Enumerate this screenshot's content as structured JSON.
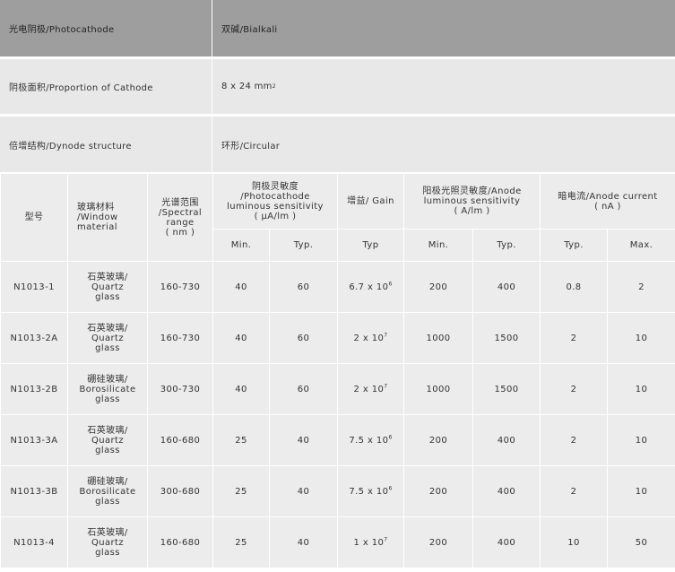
{
  "info": {
    "photocathode": {
      "label": "光电阴极/Photocathode",
      "value": "双碱/Bialkali"
    },
    "cathode_area": {
      "label": "阴极面积/Proportion of Cathode",
      "value": "8 x 24 mm",
      "sup": "2"
    },
    "dynode": {
      "label": "倍增结构/Dynode structure",
      "value": "环形/Circular"
    }
  },
  "table": {
    "headers": {
      "model": "型号",
      "window": "玻璃材料\n/Window\nmaterial",
      "spectral": "光谱范围\n/Spectral\nrange\n( nm )",
      "cathode_sens": "阴极灵敏度\n/Photocathode\nluminous sensitivity\n( μA/lm )",
      "gain": "增益/ Gain",
      "anode_sens": "阳极光照灵敏度/Anode\nluminous sensitivity\n( A/lm )",
      "dark_current": "暗电流/Anode current\n( nA )"
    },
    "subheaders": {
      "cathode_min": "Min.",
      "cathode_typ": "Typ.",
      "gain_typ": "Typ",
      "anode_min": "Min.",
      "anode_typ": "Typ.",
      "dark_typ": "Typ.",
      "dark_max": "Max."
    },
    "rows": [
      {
        "model": "N1013-1",
        "window": "石英玻璃/\nQuartz\nglass",
        "spectral": "160-730",
        "c_min": "40",
        "c_typ": "60",
        "gain_base": "6.7 x 10",
        "gain_exp": "6",
        "a_min": "200",
        "a_typ": "400",
        "d_typ": "0.8",
        "d_max": "2"
      },
      {
        "model": "N1013-2A",
        "window": "石英玻璃/\nQuartz\nglass",
        "spectral": "160-730",
        "c_min": "40",
        "c_typ": "60",
        "gain_base": "2 x 10",
        "gain_exp": "7",
        "a_min": "1000",
        "a_typ": "1500",
        "d_typ": "2",
        "d_max": "10"
      },
      {
        "model": "N1013-2B",
        "window": "硼硅玻璃/\nBorosilicate\nglass",
        "spectral": "300-730",
        "c_min": "40",
        "c_typ": "60",
        "gain_base": "2 x 10",
        "gain_exp": "7",
        "a_min": "1000",
        "a_typ": "1500",
        "d_typ": "2",
        "d_max": "10"
      },
      {
        "model": "N1013-3A",
        "window": "石英玻璃/\nQuartz\nglass",
        "spectral": "160-680",
        "c_min": "25",
        "c_typ": "40",
        "gain_base": "7.5 x 10",
        "gain_exp": "6",
        "a_min": "200",
        "a_typ": "400",
        "d_typ": "2",
        "d_max": "10"
      },
      {
        "model": "N1013-3B",
        "window": "硼硅玻璃/\nBorosilicate\nglass",
        "spectral": "300-680",
        "c_min": "25",
        "c_typ": "40",
        "gain_base": "7.5 x 10",
        "gain_exp": "6",
        "a_min": "200",
        "a_typ": "400",
        "d_typ": "2",
        "d_max": "10"
      },
      {
        "model": "N1013-4",
        "window": "石英玻璃/\nQuartz\nglass",
        "spectral": "160-680",
        "c_min": "25",
        "c_typ": "40",
        "gain_base": "1 x 10",
        "gain_exp": "7",
        "a_min": "200",
        "a_typ": "400",
        "d_typ": "10",
        "d_max": "50"
      }
    ]
  }
}
